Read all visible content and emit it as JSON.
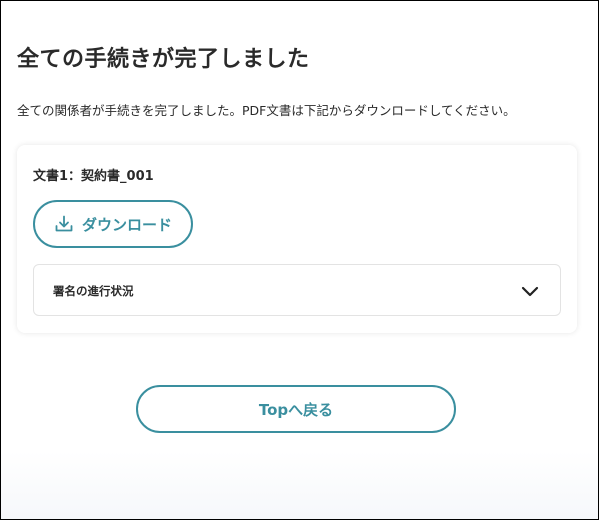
{
  "page": {
    "title": "全ての手続きが完了しました",
    "description": "全ての関係者が手続きを完了しました。PDF文書は下記からダウンロードしてください。"
  },
  "document_card": {
    "document_name": "文書1：契約書_001",
    "download_label": "ダウンロード",
    "download_icon": "download-icon",
    "accordion_label": "署名の進行状況",
    "accordion_icon": "chevron-down-icon",
    "accordion_expanded": false
  },
  "footer": {
    "back_label": "Topへ戻る"
  },
  "colors": {
    "accent": "#3a8f9f",
    "text": "#2a2a2a",
    "border": "#e3e3e3"
  }
}
